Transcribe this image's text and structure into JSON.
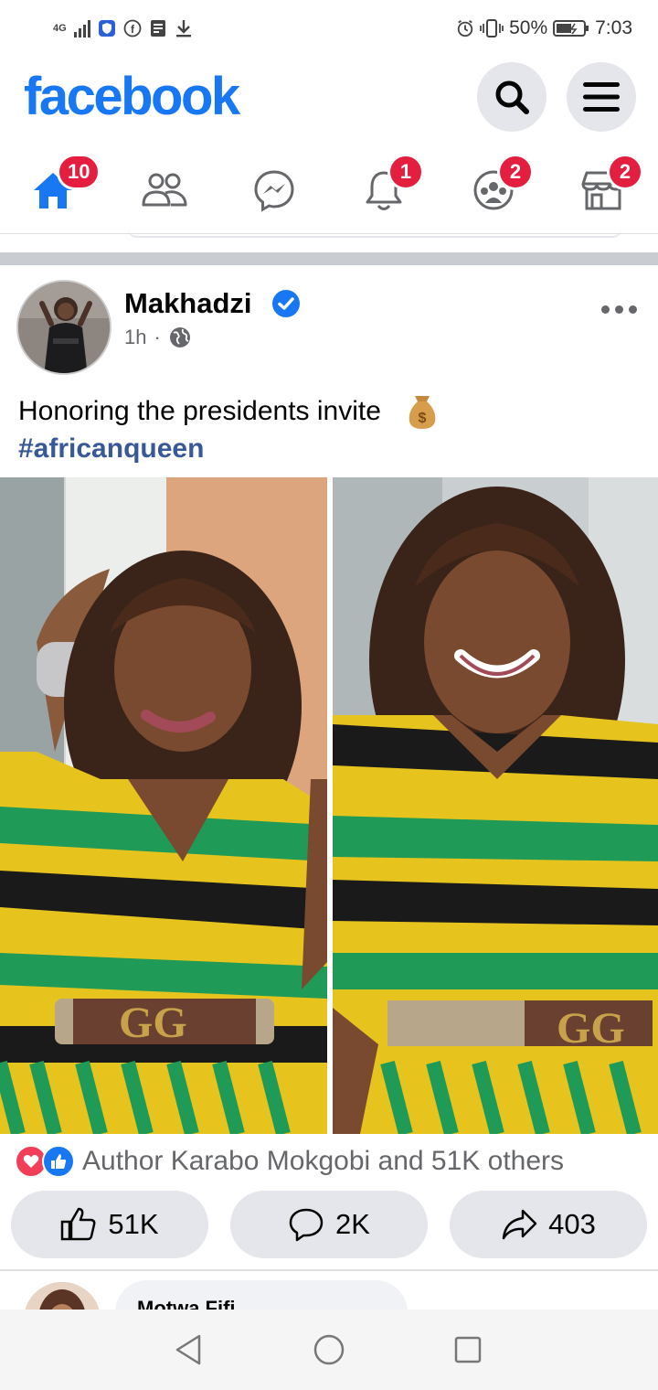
{
  "status_bar": {
    "network": "4G",
    "battery": "50%",
    "time": "7:03",
    "icons": [
      "signal-icon",
      "vpn-shield-icon",
      "facebook-notif-icon",
      "news-icon",
      "download-icon",
      "alarm-icon",
      "vibrate-icon",
      "battery-icon"
    ]
  },
  "header": {
    "logo": "facebook",
    "search_icon": "search-icon",
    "menu_icon": "menu-icon"
  },
  "nav": {
    "items": [
      {
        "name": "home",
        "icon": "home-icon",
        "badge": "10",
        "active": true
      },
      {
        "name": "friends",
        "icon": "friends-icon",
        "badge": ""
      },
      {
        "name": "messenger",
        "icon": "messenger-icon",
        "badge": ""
      },
      {
        "name": "notifications",
        "icon": "bell-icon",
        "badge": "1"
      },
      {
        "name": "groups",
        "icon": "groups-icon",
        "badge": "2"
      },
      {
        "name": "marketplace",
        "icon": "marketplace-icon",
        "badge": "2"
      }
    ]
  },
  "post": {
    "author": "Makhadzi",
    "time": "1h",
    "separator": "·",
    "text": "Honoring the presidents invite",
    "hashtag": "#africanqueen",
    "reactions_summary": "Author Karabo Mokgobi and 51K others",
    "like_count": "51K",
    "comment_count": "2K",
    "share_count": "403"
  },
  "next_post": {
    "author": "Motwa Fifi"
  },
  "colors": {
    "brand": "#1877f2",
    "badge": "#e41e3f",
    "hashtag": "#385898",
    "button_bg": "#e4e6eb"
  }
}
